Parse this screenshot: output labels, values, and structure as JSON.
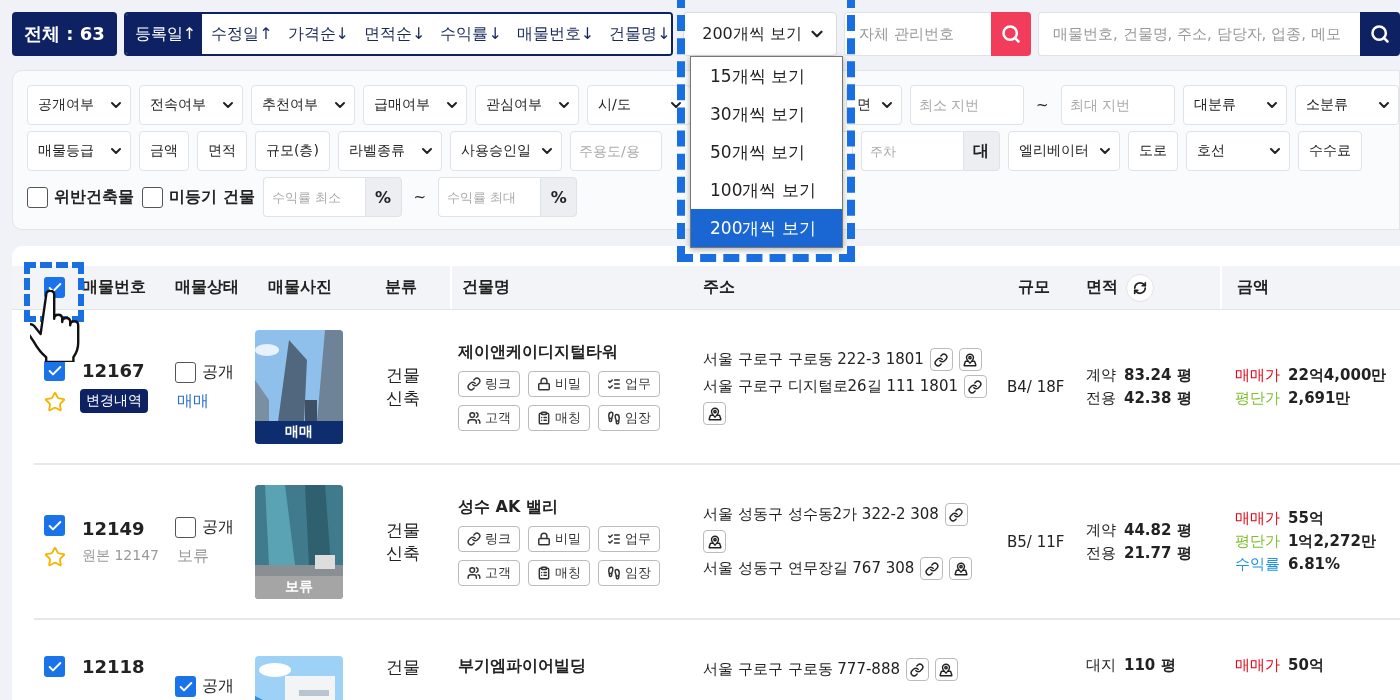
{
  "total_badge": "전체 : 63",
  "sort_options": [
    {
      "label": "등록일↑",
      "selected": true
    },
    {
      "label": "수정일↑",
      "selected": false
    },
    {
      "label": "가격순↓",
      "selected": false
    },
    {
      "label": "면적순↓",
      "selected": false
    },
    {
      "label": "수익률↓",
      "selected": false
    },
    {
      "label": "매물번호↓",
      "selected": false
    },
    {
      "label": "건물명↓",
      "selected": false
    }
  ],
  "page_size_select": {
    "value": "200개씩 보기",
    "expanded": true,
    "options": [
      {
        "label": "15개씩 보기",
        "selected": false
      },
      {
        "label": "30개씩 보기",
        "selected": false
      },
      {
        "label": "50개씩 보기",
        "selected": false
      },
      {
        "label": "100개씩 보기",
        "selected": false
      },
      {
        "label": "200개씩 보기",
        "selected": true
      }
    ]
  },
  "own_number_search": {
    "placeholder": "자체 관리번호"
  },
  "main_search": {
    "placeholder": "매물번호, 건물명, 주소, 담당자, 업종, 메모"
  },
  "filter_rows": [
    [
      {
        "kind": "select",
        "label": "공개여부"
      },
      {
        "kind": "select",
        "label": "전속여부"
      },
      {
        "kind": "select",
        "label": "추천여부"
      },
      {
        "kind": "select",
        "label": "급매여부"
      },
      {
        "kind": "select",
        "label": "관심여부"
      },
      {
        "kind": "select",
        "label": "시/도"
      },
      {
        "kind": "gap"
      },
      {
        "kind": "covered_select",
        "label": "면"
      },
      {
        "kind": "input",
        "placeholder": "최소 지번"
      },
      {
        "kind": "tilde",
        "label": "~"
      },
      {
        "kind": "input",
        "placeholder": "최대 지번"
      },
      {
        "kind": "select",
        "label": "대분류"
      },
      {
        "kind": "select",
        "label": "소분류"
      }
    ],
    [
      {
        "kind": "select",
        "label": "매물등급"
      },
      {
        "kind": "button",
        "label": "금액"
      },
      {
        "kind": "button",
        "label": "면적"
      },
      {
        "kind": "button",
        "label": "규모(층)"
      },
      {
        "kind": "select",
        "label": "라벨종류"
      },
      {
        "kind": "select",
        "label": "사용승인일"
      },
      {
        "kind": "covered_input",
        "placeholder": "주용도/용"
      },
      {
        "kind": "gap"
      },
      {
        "kind": "covered_input"
      },
      {
        "kind": "unit_input",
        "placeholder": "주차",
        "unit": "대"
      },
      {
        "kind": "select",
        "label": "엘리베이터"
      },
      {
        "kind": "button",
        "label": "도로"
      },
      {
        "kind": "select",
        "label": "호선"
      },
      {
        "kind": "button",
        "label": "수수료"
      }
    ],
    [
      {
        "kind": "checkbox",
        "label": "위반건축물",
        "checked": false
      },
      {
        "kind": "checkbox",
        "label": "미등기 건물",
        "checked": false
      },
      {
        "kind": "unit_input",
        "placeholder": "수익률 최소",
        "unit": "%"
      },
      {
        "kind": "tilde",
        "label": "~"
      },
      {
        "kind": "unit_input",
        "placeholder": "수익률 최대",
        "unit": "%"
      }
    ]
  ],
  "table": {
    "all_checked": true,
    "columns": [
      "매물번호",
      "매물상태",
      "매물사진",
      "분류",
      "건물명",
      "주소",
      "규모",
      "면적",
      "금액"
    ],
    "rows": [
      {
        "checked": true,
        "starred": false,
        "number": "12167",
        "badge": "변경내역",
        "public_label": "공개",
        "public": false,
        "deal": "매매",
        "kind": "sale",
        "photo": {
          "kind": "picture"
        },
        "photo_label": "매매",
        "category": "건물 신축",
        "building": "제이앤케이디지털타워",
        "tags": [
          {
            "kind": "link",
            "label": "링크"
          },
          {
            "kind": "secret",
            "label": "비밀"
          },
          {
            "kind": "task",
            "label": "업무"
          },
          {
            "kind": "client",
            "label": "고객"
          },
          {
            "kind": "match",
            "label": "매칭"
          },
          {
            "kind": "visit",
            "label": "임장"
          }
        ],
        "addresses": [
          "서울 구로구 구로동 222-3 1801",
          "서울 구로구 디지털로26길 111 1801"
        ],
        "scale": "B4/ 18F",
        "areas": [
          {
            "label": "계약",
            "value": "83.24 평"
          },
          {
            "label": "전용",
            "value": "42.38 평"
          }
        ],
        "prices": [
          {
            "kind": "sale",
            "label": "매매가",
            "value": "22억4,000만"
          },
          {
            "kind": "unit",
            "label": "평단가",
            "value": "2,691만"
          }
        ]
      },
      {
        "checked": true,
        "starred": false,
        "number": "12149",
        "original": "원본 12147",
        "public_label": "공개",
        "public": false,
        "deal": "보류",
        "kind": "hold",
        "photo": {
          "kind": "picture"
        },
        "photo_label": "보류",
        "category": "건물 신축",
        "building": "성수 AK 밸리",
        "tags": [
          {
            "kind": "link",
            "label": "링크"
          },
          {
            "kind": "secret",
            "label": "비밀"
          },
          {
            "kind": "task",
            "label": "업무"
          },
          {
            "kind": "client",
            "label": "고객"
          },
          {
            "kind": "match",
            "label": "매칭"
          },
          {
            "kind": "visit",
            "label": "임장"
          }
        ],
        "addresses": [
          "서울 성동구 성수동2가 322-2 308",
          "서울 성동구 연무장길 767 308"
        ],
        "scale": "B5/ 11F",
        "areas": [
          {
            "label": "계약",
            "value": "44.82 평"
          },
          {
            "label": "전용",
            "value": "21.77 평"
          }
        ],
        "prices": [
          {
            "kind": "sale",
            "label": "매매가",
            "value": "55억"
          },
          {
            "kind": "unit",
            "label": "평단가",
            "value": "1억2,272만"
          },
          {
            "kind": "yield",
            "label": "수익률",
            "value": "6.81%"
          }
        ]
      },
      {
        "checked": true,
        "number": "12118",
        "public_label": "공개",
        "public": true,
        "photo": {
          "kind": "picture"
        },
        "category": "건물",
        "building": "부기엠파이어빌딩",
        "addresses": [
          "서울 구로구 구로동 777-888"
        ],
        "areas": [
          {
            "label": "대지",
            "value": "110 평"
          }
        ],
        "prices": [
          {
            "kind": "sale",
            "label": "매매가",
            "value": "50억"
          }
        ]
      }
    ]
  }
}
